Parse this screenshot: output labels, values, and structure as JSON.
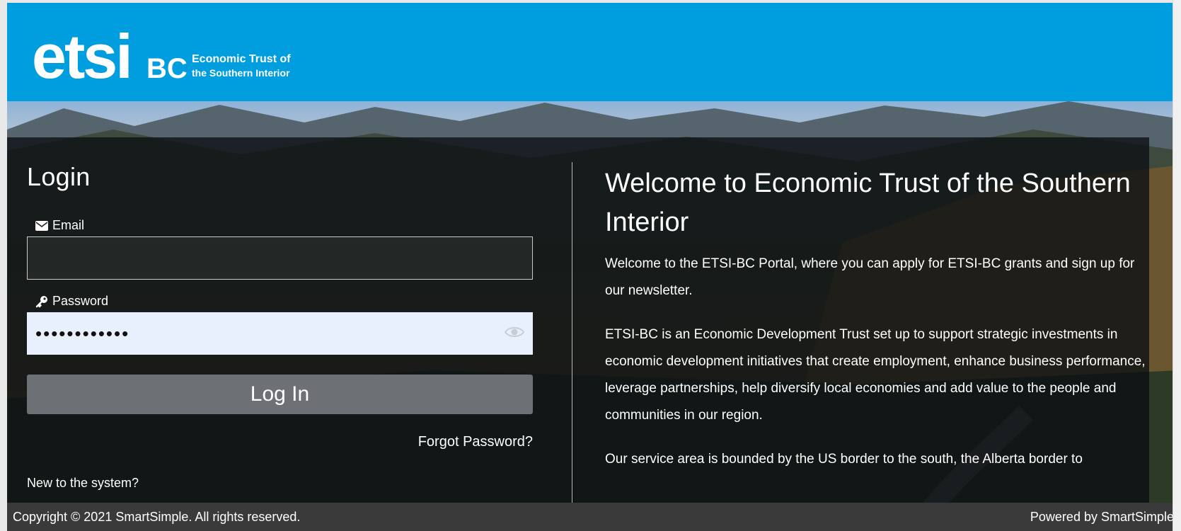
{
  "brand": {
    "logo_wordmark": "etsi",
    "logo_suffix": "BC",
    "logo_tagline_1": "Economic Trust of",
    "logo_tagline_2": "the Southern Interior",
    "header_color": "#009ddf"
  },
  "login": {
    "title": "Login",
    "email_label": "Email",
    "email_icon": "envelope-icon",
    "email_value": "",
    "password_label": "Password",
    "password_icon": "key-icon",
    "password_value": "••••••••••••",
    "show_password_icon": "eye-icon",
    "login_button": "Log In",
    "forgot_password": "Forgot Password?",
    "new_to_system": "New to the system?"
  },
  "welcome": {
    "title": "Welcome to Economic Trust of the Southern Interior",
    "paragraphs": [
      "Welcome to the ETSI-BC Portal, where you can apply for ETSI-BC grants and sign up for our newsletter.",
      "ETSI-BC is an Economic Development Trust set up to support strategic investments in economic development initiatives that create employment, enhance business performance, leverage partnerships, help diversify local economies and add value to the people and communities in our region.",
      "Our service area is bounded by the US border to the south, the Alberta border to"
    ]
  },
  "footer": {
    "copyright": "Copyright © 2021 SmartSimple. All rights reserved.",
    "powered_by": "Powered by SmartSimple"
  }
}
